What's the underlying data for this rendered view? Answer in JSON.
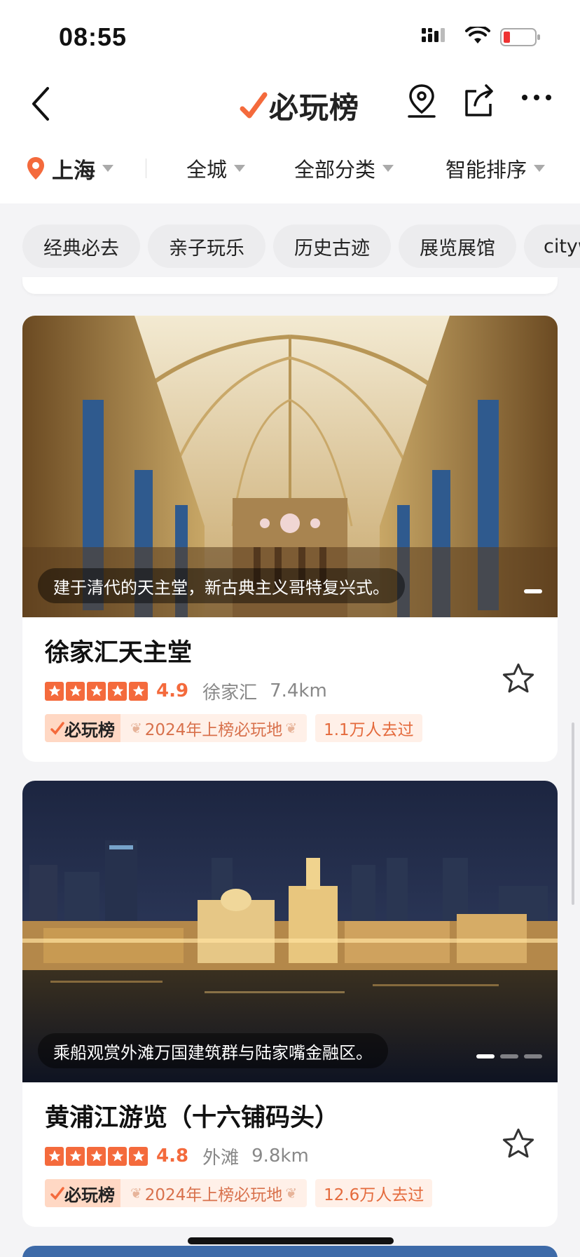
{
  "status_bar": {
    "time": "08:55"
  },
  "nav": {
    "logo_text": "必玩榜"
  },
  "filters": {
    "city": "上海",
    "items": [
      {
        "label": "全城"
      },
      {
        "label": "全部分类"
      },
      {
        "label": "智能排序"
      }
    ]
  },
  "chips": [
    {
      "label": "经典必去"
    },
    {
      "label": "亲子玩乐"
    },
    {
      "label": "历史古迹"
    },
    {
      "label": "展览展馆"
    },
    {
      "label": "cityw"
    }
  ],
  "cards": [
    {
      "caption": "建于清代的天主堂，新古典主义哥特复兴式。",
      "title": "徐家汇天主堂",
      "score": "4.9",
      "stars": 5,
      "area": "徐家汇",
      "distance": "7.4km",
      "badge_logo": "必玩榜",
      "award": "2024年上榜必玩地",
      "visits": "1.1万人去过",
      "image_dots": 1
    },
    {
      "caption": "乘船观赏外滩万国建筑群与陆家嘴金融区。",
      "title": "黄浦江游览（十六铺码头）",
      "score": "4.8",
      "stars": 5,
      "area": "外滩",
      "distance": "9.8km",
      "badge_logo": "必玩榜",
      "award": "2024年上榜必玩地",
      "visits": "12.6万人去过",
      "image_dots": 3
    }
  ],
  "colors": {
    "accent": "#f46a3c",
    "badge_bg": "#fff0e8",
    "page_bg": "#f4f4f6"
  }
}
